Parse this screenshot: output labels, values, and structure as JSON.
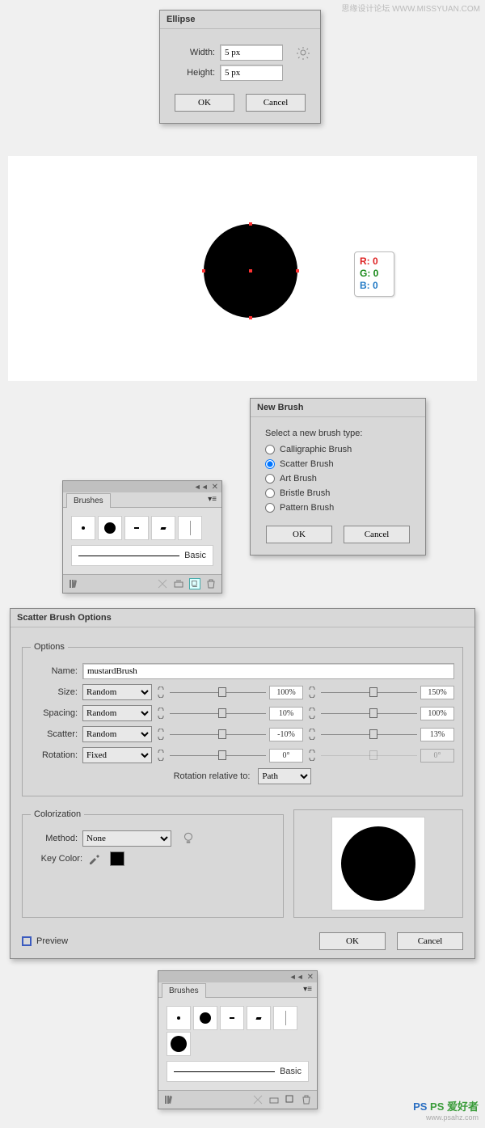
{
  "watermark1": "思缘设计论坛  WWW.MISSYUAN.COM",
  "watermark2_a": "PS 爱好者",
  "watermark2_b": "www.psahz.com",
  "ellipse": {
    "title": "Ellipse",
    "width_label": "Width:",
    "width": "5 px",
    "height_label": "Height:",
    "height": "5 px",
    "ok": "OK",
    "cancel": "Cancel"
  },
  "rgb": {
    "r": "R: 0",
    "g": "G: 0",
    "b": "B: 0"
  },
  "brushesPanel": {
    "title": "Brushes",
    "basic": "Basic"
  },
  "newBrush": {
    "title": "New Brush",
    "prompt": "Select a new brush type:",
    "opts": [
      "Calligraphic Brush",
      "Scatter Brush",
      "Art Brush",
      "Bristle Brush",
      "Pattern Brush"
    ],
    "ok": "OK",
    "cancel": "Cancel"
  },
  "sbo": {
    "title": "Scatter Brush Options",
    "legend_opts": "Options",
    "name_label": "Name:",
    "name": "mustardBrush",
    "rows": [
      {
        "label": "Size:",
        "mode": "Random",
        "v1": "100%",
        "v2": "150%"
      },
      {
        "label": "Spacing:",
        "mode": "Random",
        "v1": "10%",
        "v2": "100%"
      },
      {
        "label": "Scatter:",
        "mode": "Random",
        "v1": "-10%",
        "v2": "13%"
      },
      {
        "label": "Rotation:",
        "mode": "Fixed",
        "v1": "0°",
        "v2": "0°"
      }
    ],
    "rotrel_label": "Rotation relative to:",
    "rotrel": "Path",
    "legend_col": "Colorization",
    "method_label": "Method:",
    "method": "None",
    "key_label": "Key Color:",
    "preview": "Preview",
    "ok": "OK",
    "cancel": "Cancel"
  },
  "brushesPanel2": {
    "title": "Brushes",
    "basic": "Basic"
  }
}
